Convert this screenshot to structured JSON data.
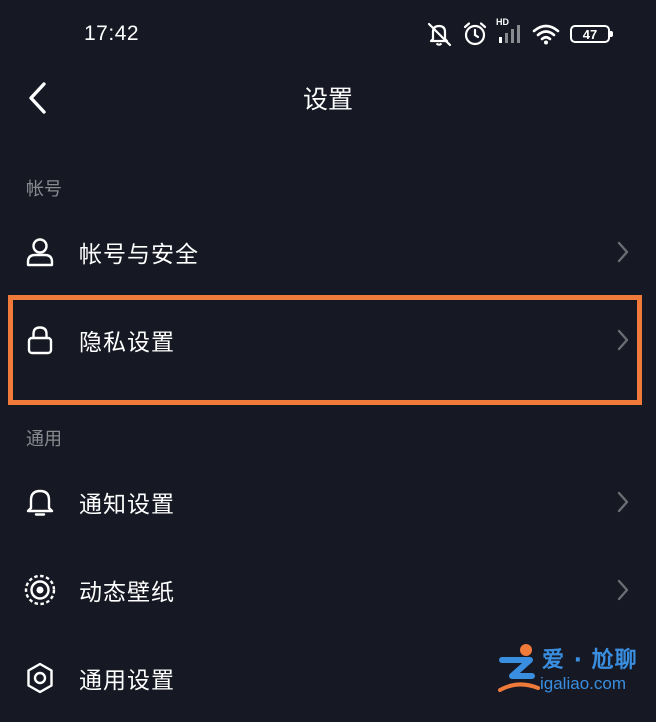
{
  "status_bar": {
    "time": "17:42",
    "network_label": "HD",
    "battery": "47",
    "icons": [
      "mute-icon",
      "alarm-icon",
      "signal-icon",
      "wifi-icon",
      "battery-icon"
    ]
  },
  "header": {
    "title": "设置",
    "back_icon": "chevron-left-icon"
  },
  "sections": [
    {
      "label": "帐号",
      "items": [
        {
          "label": "帐号与安全",
          "icon": "user-icon"
        },
        {
          "label": "隐私设置",
          "icon": "lock-icon",
          "highlighted": true
        }
      ]
    },
    {
      "label": "通用",
      "items": [
        {
          "label": "通知设置",
          "icon": "bell-icon"
        },
        {
          "label": "动态壁纸",
          "icon": "live-wallpaper-icon"
        },
        {
          "label": "通用设置",
          "icon": "gear-icon"
        }
      ]
    }
  ],
  "watermark": {
    "title": "爱 · 尬聊",
    "url": "igaliao.com"
  },
  "colors": {
    "background": "#161823",
    "text": "#ffffff",
    "section_label": "#8a8b91",
    "highlight": "#f07a3a",
    "watermark": "#3a8ee0"
  }
}
